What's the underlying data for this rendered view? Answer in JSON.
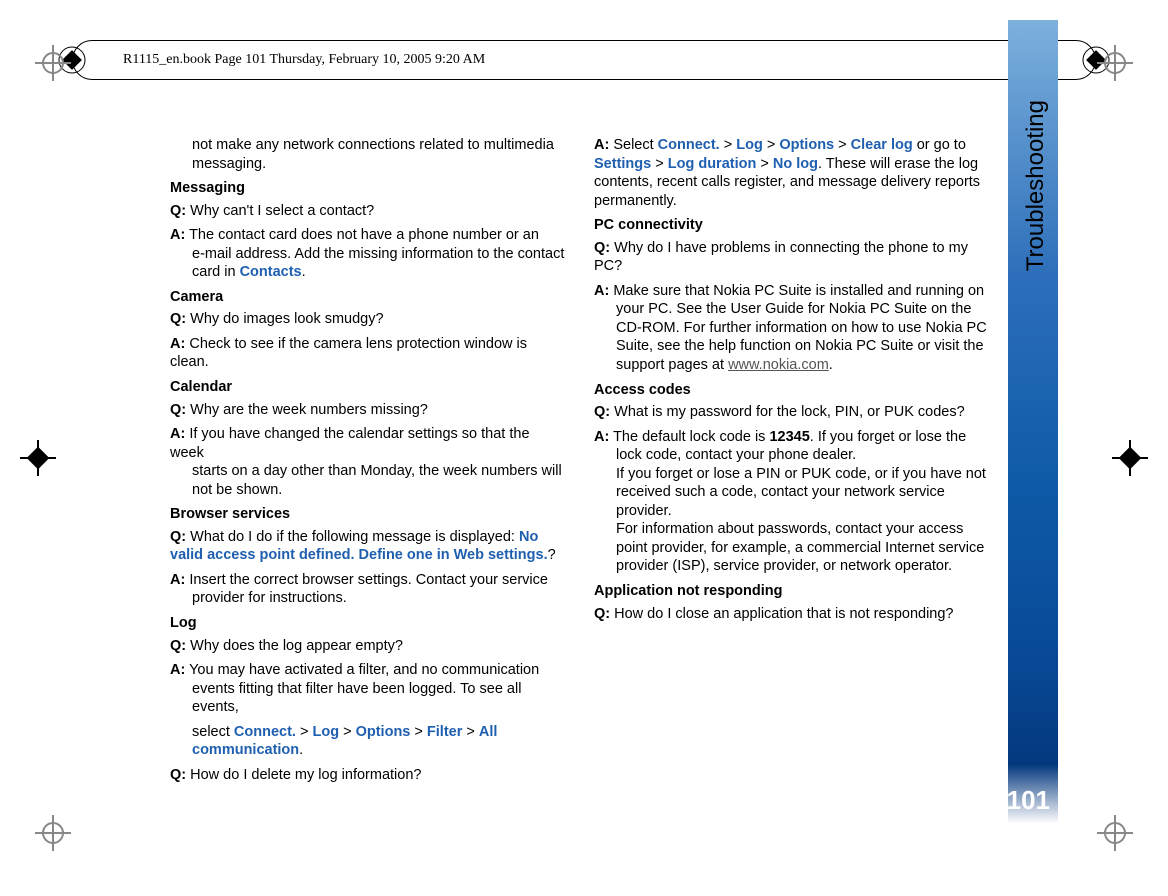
{
  "header": {
    "book_meta": "R1115_en.book  Page 101  Thursday, February 10, 2005  9:20 AM"
  },
  "side": {
    "label": "Troubleshooting",
    "page_number": "101"
  },
  "c": {
    "frag1": "not make any network connections related to multimedia messaging.",
    "h_messaging": "Messaging",
    "q_messaging": "Q:",
    "q_messaging_t": " Why can't I select a contact?",
    "a_messaging": "A:",
    "a_messaging_t1": " The contact card does not have a phone number or an",
    "a_messaging_t2": "e-mail address. Add the missing information to the contact card in ",
    "contacts": "Contacts",
    "h_camera": "Camera",
    "q_camera": "Q:",
    "q_camera_t": " Why do images look smudgy?",
    "a_camera": "A:",
    "a_camera_t": " Check to see if the camera lens protection window is clean.",
    "h_calendar": "Calendar",
    "q_calendar": "Q:",
    "q_calendar_t": " Why are the week numbers missing?",
    "a_calendar": "A:",
    "a_calendar_t1": " If you have changed the calendar settings so that the week",
    "a_calendar_t2": "starts on a day other than Monday, the week numbers will not be shown.",
    "h_browser": "Browser services",
    "q_browser": "Q:",
    "q_browser_t1": " What do I do if the following message is displayed: ",
    "q_browser_blue": "No valid access point defined. Define one in Web settings.",
    "q_browser_t2": "?",
    "a_browser": "A:",
    "a_browser_t1": " Insert the correct browser settings. Contact your service",
    "a_browser_t2": "provider for instructions.",
    "h_log": "Log",
    "q_log": "Q:",
    "q_log_t": " Why does the log appear empty?",
    "a_log": "A:",
    "a_log_t1": " You may have activated a filter, and no communication",
    "a_log_t2": "events fitting that filter have been logged. To see all events,",
    "a_log_cont1": "select ",
    "connect": "Connect.",
    "gt": " > ",
    "log_b": "Log",
    "options": "Options",
    "filter": "Filter",
    "all_comm": "All communication",
    "period": ".",
    "q_log2": "Q:",
    "q_log2_t": " How do I delete my log information?",
    "a_log2": "A:",
    "a_log2_t1": " Select ",
    "clear_log": "Clear log",
    "a_log2_t2": " or go to ",
    "settings": "Settings",
    "log_dur": "Log duration",
    "no_log": "No log",
    "a_log2_t3": ". These will erase the log contents, recent calls register, and message delivery reports permanently.",
    "h_pc": "PC connectivity",
    "q_pc": "Q:",
    "q_pc_t": " Why do I have problems in connecting the phone to my PC?",
    "a_pc": "A:",
    "a_pc_t1": " Make sure that Nokia PC Suite is installed and running on",
    "a_pc_t2": "your PC. See the User Guide for Nokia PC Suite on the CD-ROM. For further information on how to use Nokia PC Suite, see the help function on Nokia PC Suite or visit the support pages at ",
    "nokia_url": "www.nokia.com",
    "h_access": "Access codes",
    "q_access": "Q:",
    "q_access_t": " What is my password for the lock, PIN, or PUK codes?",
    "a_access": "A:",
    "a_access_t1": " The default lock code is ",
    "code12345": "12345",
    "a_access_t2": ". If you forget or lose the",
    "a_access_t3": "lock code, contact your phone dealer.",
    "a_access_t4": "If you forget or lose a PIN or PUK code, or if you have not received such a code, contact your network service provider.",
    "a_access_t5": "For information about passwords, contact your access point provider, for example, a commercial Internet service provider (ISP), service provider, or network operator.",
    "h_app": "Application not responding",
    "q_app": "Q:",
    "q_app_t": " How do I close an application that is not responding?"
  }
}
